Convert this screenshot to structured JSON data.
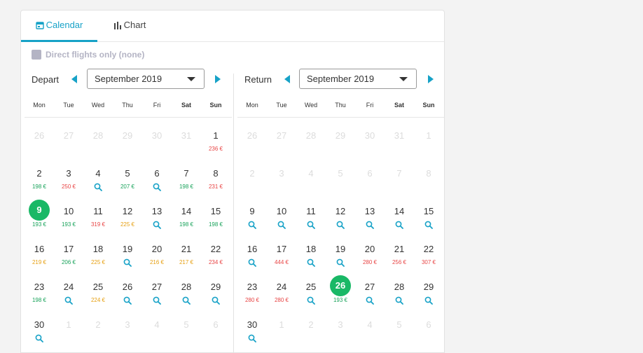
{
  "tabs": [
    {
      "label": "Calendar",
      "icon": "calendar-icon",
      "active": true
    },
    {
      "label": "Chart",
      "icon": "bar-chart-icon",
      "active": false
    }
  ],
  "filter": {
    "label": "Direct flights only (none)",
    "checked": false
  },
  "colors": {
    "accent": "#17a2c7",
    "selected": "#19b866",
    "cheap": "#19a35b",
    "mid": "#e6a013",
    "expensive": "#e84545"
  },
  "weekdays": [
    "Mon",
    "Tue",
    "Wed",
    "Thu",
    "Fri",
    "Sat",
    "Sun"
  ],
  "depart": {
    "label": "Depart",
    "month": "September 2019",
    "days": [
      {
        "n": "26",
        "muted": true
      },
      {
        "n": "27",
        "muted": true
      },
      {
        "n": "28",
        "muted": true
      },
      {
        "n": "29",
        "muted": true
      },
      {
        "n": "30",
        "muted": true
      },
      {
        "n": "31",
        "muted": true
      },
      {
        "n": "1",
        "price": "236 €",
        "tone": "red"
      },
      {
        "n": "2",
        "price": "198 €",
        "tone": "green"
      },
      {
        "n": "3",
        "price": "250 €",
        "tone": "red"
      },
      {
        "n": "4",
        "search": true
      },
      {
        "n": "5",
        "price": "207 €",
        "tone": "green"
      },
      {
        "n": "6",
        "search": true
      },
      {
        "n": "7",
        "price": "198 €",
        "tone": "green"
      },
      {
        "n": "8",
        "price": "231 €",
        "tone": "red"
      },
      {
        "n": "9",
        "price": "193 €",
        "tone": "green",
        "selected": true
      },
      {
        "n": "10",
        "price": "193 €",
        "tone": "green"
      },
      {
        "n": "11",
        "price": "319 €",
        "tone": "red"
      },
      {
        "n": "12",
        "price": "225 €",
        "tone": "orange"
      },
      {
        "n": "13",
        "search": true
      },
      {
        "n": "14",
        "price": "198 €",
        "tone": "green"
      },
      {
        "n": "15",
        "price": "198 €",
        "tone": "green"
      },
      {
        "n": "16",
        "price": "219 €",
        "tone": "orange"
      },
      {
        "n": "17",
        "price": "206 €",
        "tone": "green"
      },
      {
        "n": "18",
        "price": "225 €",
        "tone": "orange"
      },
      {
        "n": "19",
        "search": true
      },
      {
        "n": "20",
        "price": "216 €",
        "tone": "orange"
      },
      {
        "n": "21",
        "price": "217 €",
        "tone": "orange"
      },
      {
        "n": "22",
        "price": "234 €",
        "tone": "red"
      },
      {
        "n": "23",
        "price": "198 €",
        "tone": "green"
      },
      {
        "n": "24",
        "search": true
      },
      {
        "n": "25",
        "price": "224 €",
        "tone": "orange"
      },
      {
        "n": "26",
        "search": true
      },
      {
        "n": "27",
        "search": true
      },
      {
        "n": "28",
        "search": true
      },
      {
        "n": "29",
        "search": true
      },
      {
        "n": "30",
        "search": true
      },
      {
        "n": "1",
        "muted": true
      },
      {
        "n": "2",
        "muted": true
      },
      {
        "n": "3",
        "muted": true
      },
      {
        "n": "4",
        "muted": true
      },
      {
        "n": "5",
        "muted": true
      },
      {
        "n": "6",
        "muted": true
      }
    ]
  },
  "return": {
    "label": "Return",
    "month": "September 2019",
    "days": [
      {
        "n": "26",
        "muted": true
      },
      {
        "n": "27",
        "muted": true
      },
      {
        "n": "28",
        "muted": true
      },
      {
        "n": "29",
        "muted": true
      },
      {
        "n": "30",
        "muted": true
      },
      {
        "n": "31",
        "muted": true
      },
      {
        "n": "1",
        "muted": true
      },
      {
        "n": "2",
        "muted": true
      },
      {
        "n": "3",
        "muted": true
      },
      {
        "n": "4",
        "muted": true
      },
      {
        "n": "5",
        "muted": true
      },
      {
        "n": "6",
        "muted": true
      },
      {
        "n": "7",
        "muted": true
      },
      {
        "n": "8",
        "muted": true
      },
      {
        "n": "9",
        "search": true
      },
      {
        "n": "10",
        "search": true
      },
      {
        "n": "11",
        "search": true
      },
      {
        "n": "12",
        "search": true
      },
      {
        "n": "13",
        "search": true
      },
      {
        "n": "14",
        "search": true
      },
      {
        "n": "15",
        "search": true
      },
      {
        "n": "16",
        "search": true
      },
      {
        "n": "17",
        "price": "444 €",
        "tone": "red"
      },
      {
        "n": "18",
        "search": true
      },
      {
        "n": "19",
        "search": true
      },
      {
        "n": "20",
        "price": "280 €",
        "tone": "red"
      },
      {
        "n": "21",
        "price": "256 €",
        "tone": "red"
      },
      {
        "n": "22",
        "price": "307 €",
        "tone": "red"
      },
      {
        "n": "23",
        "price": "280 €",
        "tone": "red"
      },
      {
        "n": "24",
        "price": "280 €",
        "tone": "red"
      },
      {
        "n": "25",
        "search": true
      },
      {
        "n": "26",
        "price": "193 €",
        "tone": "green",
        "selected": true
      },
      {
        "n": "27",
        "search": true
      },
      {
        "n": "28",
        "search": true
      },
      {
        "n": "29",
        "search": true
      },
      {
        "n": "30",
        "search": true
      },
      {
        "n": "1",
        "muted": true
      },
      {
        "n": "2",
        "muted": true
      },
      {
        "n": "3",
        "muted": true
      },
      {
        "n": "4",
        "muted": true
      },
      {
        "n": "5",
        "muted": true
      },
      {
        "n": "6",
        "muted": true
      }
    ]
  }
}
